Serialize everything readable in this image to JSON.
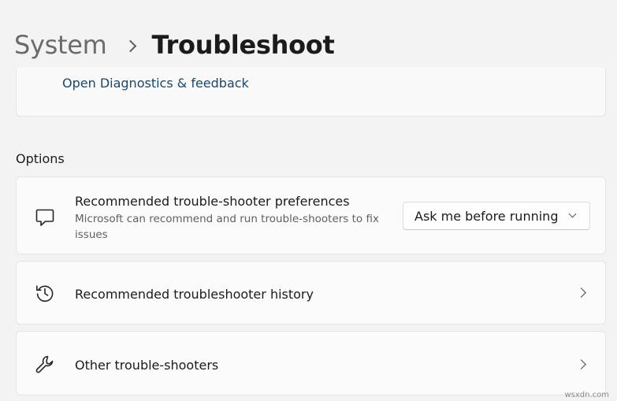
{
  "breadcrumb": {
    "parent": "System",
    "current": "Troubleshoot"
  },
  "feedback": {
    "link_text": "Open Diagnostics & feedback"
  },
  "options": {
    "section_title": "Options",
    "items": [
      {
        "title": "Recommended trouble-shooter preferences",
        "description": "Microsoft can recommend and run trouble-shooters to fix issues",
        "icon": "chat-bubble-icon",
        "dropdown_value": "Ask me before running"
      },
      {
        "title": "Recommended troubleshooter history",
        "icon": "history-icon"
      },
      {
        "title": "Other trouble-shooters",
        "icon": "wrench-icon"
      }
    ]
  },
  "watermark": "wsxdn.com"
}
